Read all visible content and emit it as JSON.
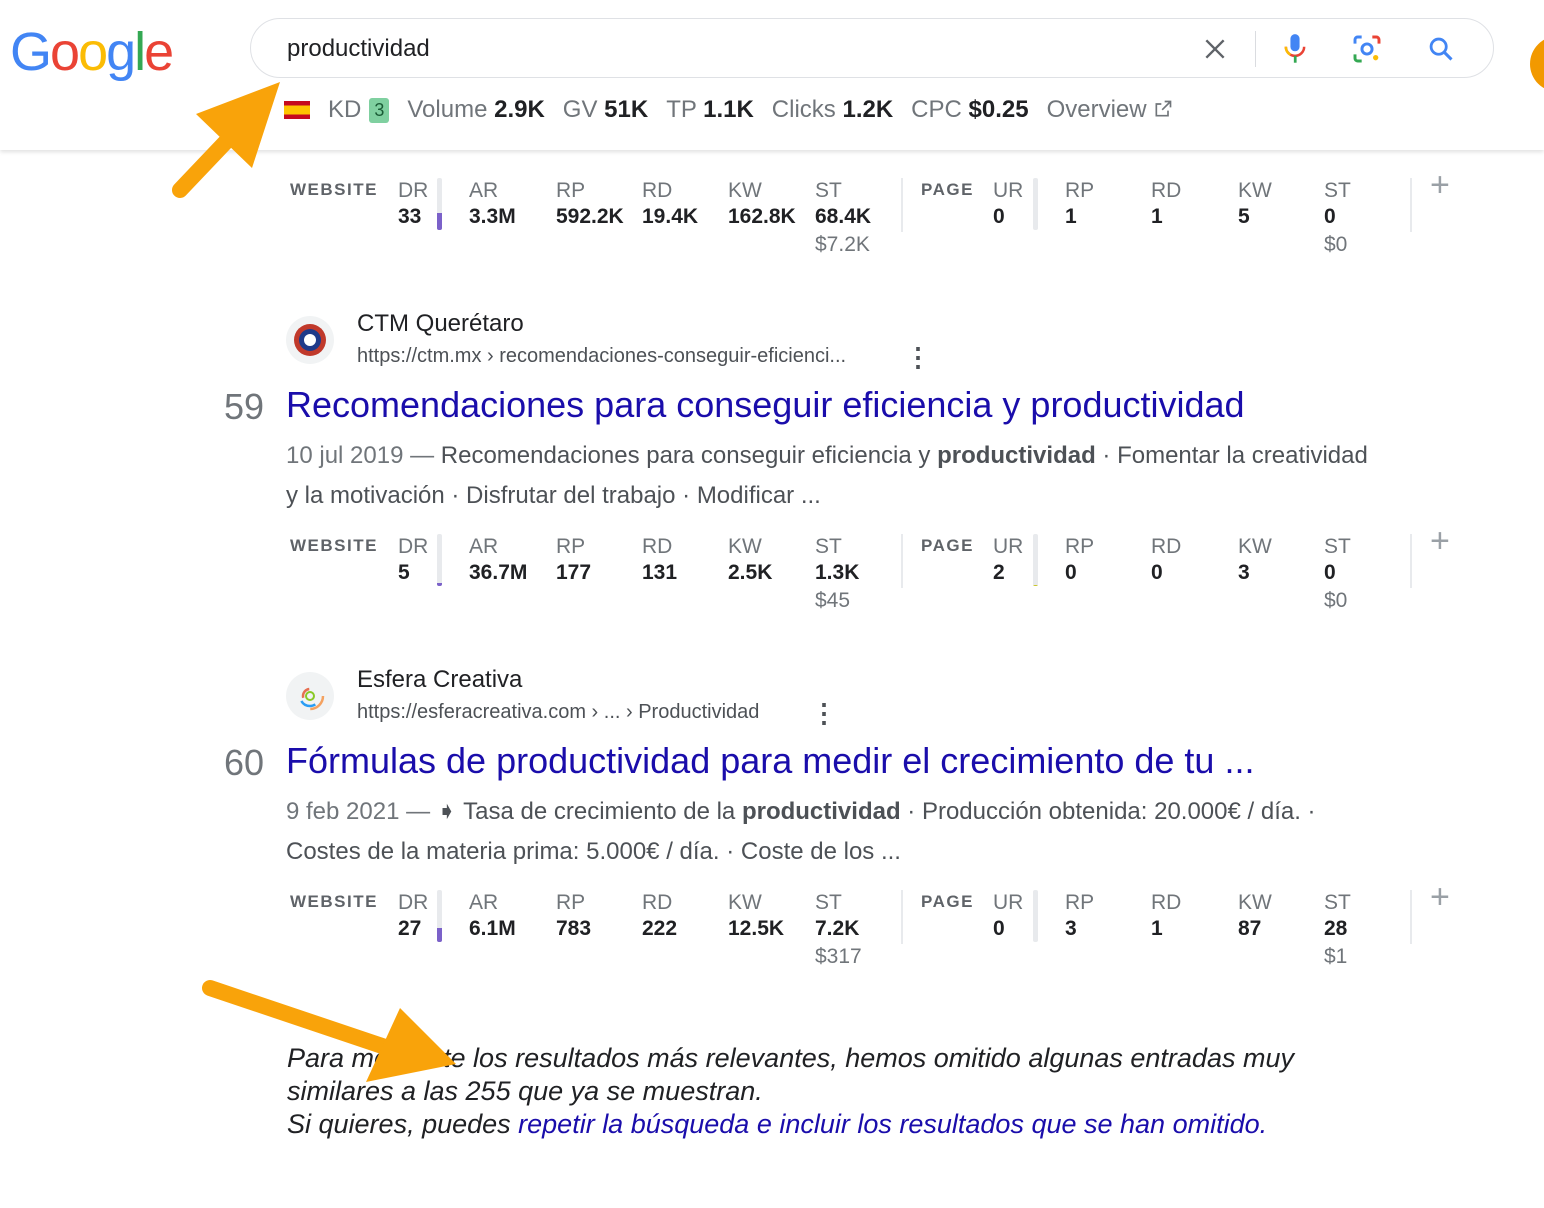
{
  "logo": {
    "letters": [
      "G",
      "o",
      "o",
      "g",
      "l",
      "e"
    ],
    "colors": [
      "#4285F4",
      "#EA4335",
      "#FBBC05",
      "#4285F4",
      "#34A853",
      "#EA4335"
    ]
  },
  "search": {
    "query": "productividad",
    "icons": [
      "close-icon",
      "mic-icon",
      "lens-icon",
      "search-icon"
    ]
  },
  "keyword_bar": {
    "kd_label": "KD",
    "kd_value": "3",
    "volume_label": "Volume",
    "volume_value": "2.9K",
    "gv_label": "GV",
    "gv_value": "51K",
    "tp_label": "TP",
    "tp_value": "1.1K",
    "clicks_label": "Clicks",
    "clicks_value": "1.2K",
    "cpc_label": "CPC",
    "cpc_value": "$0.25",
    "overview_label": "Overview"
  },
  "metric_labels": {
    "website": "WEBSITE",
    "page": "PAGE",
    "dr": "DR",
    "ar": "AR",
    "rp": "RP",
    "rd": "RD",
    "kw": "KW",
    "st": "ST",
    "ur": "UR",
    "plus": "+"
  },
  "results": [
    {
      "metrics": {
        "dr": "33",
        "dr_fill": 0.33,
        "ar": "3.3M",
        "rp": "592.2K",
        "rd": "19.4K",
        "kw": "162.8K",
        "st": "68.4K",
        "st_cost": "$7.2K",
        "ur": "0",
        "ur_fill": 0.0,
        "p_rp": "1",
        "p_rd": "1",
        "p_kw": "5",
        "p_st": "0",
        "p_st_cost": "$0"
      }
    },
    {
      "site_name": "CTM Querétaro",
      "url": "https://ctm.mx › recomendaciones-conseguir-eficienci...",
      "rank": "59",
      "title": "Recomendaciones para conseguir eficiencia y productividad",
      "date": "10 jul 2019 —",
      "snippet_pre": " Recomendaciones para conseguir eficiencia y ",
      "snippet_bold": "productividad",
      "snippet_post": " · Fomentar la creatividad y la motivación · Disfrutar del trabajo · Modificar ...",
      "metrics": {
        "dr": "5",
        "dr_fill": 0.05,
        "ar": "36.7M",
        "rp": "177",
        "rd": "131",
        "kw": "2.5K",
        "st": "1.3K",
        "st_cost": "$45",
        "ur": "2",
        "ur_fill": 0.02,
        "p_rp": "0",
        "p_rd": "0",
        "p_kw": "3",
        "p_st": "0",
        "p_st_cost": "$0"
      }
    },
    {
      "site_name": "Esfera Creativa",
      "url": "https://esferacreativa.com › ... › Productividad",
      "rank": "60",
      "title": "Fórmulas de productividad para medir el crecimiento de tu ...",
      "date": "9 feb 2021 —",
      "snippet_pre": " ➧ Tasa de crecimiento de la ",
      "snippet_bold": "productividad",
      "snippet_post": " · Producción obtenida: 20.000€ / día. · Costes de la materia prima: 5.000€ / día. · Coste de los ...",
      "metrics": {
        "dr": "27",
        "dr_fill": 0.27,
        "ar": "6.1M",
        "rp": "783",
        "rd": "222",
        "kw": "12.5K",
        "st": "7.2K",
        "st_cost": "$317",
        "ur": "0",
        "ur_fill": 0.0,
        "p_rp": "3",
        "p_rd": "1",
        "p_kw": "87",
        "p_st": "28",
        "p_st_cost": "$1"
      }
    }
  ],
  "omitted": {
    "line1": "Para mostrarte los resultados más relevantes, hemos omitido algunas entradas muy similares a las 255 que ya se muestran.",
    "line2_pre": "Si quieres, puedes ",
    "line2_link": "repetir la búsqueda e incluir los resultados que se han omitido."
  },
  "annotation_color": "#F9A30A"
}
